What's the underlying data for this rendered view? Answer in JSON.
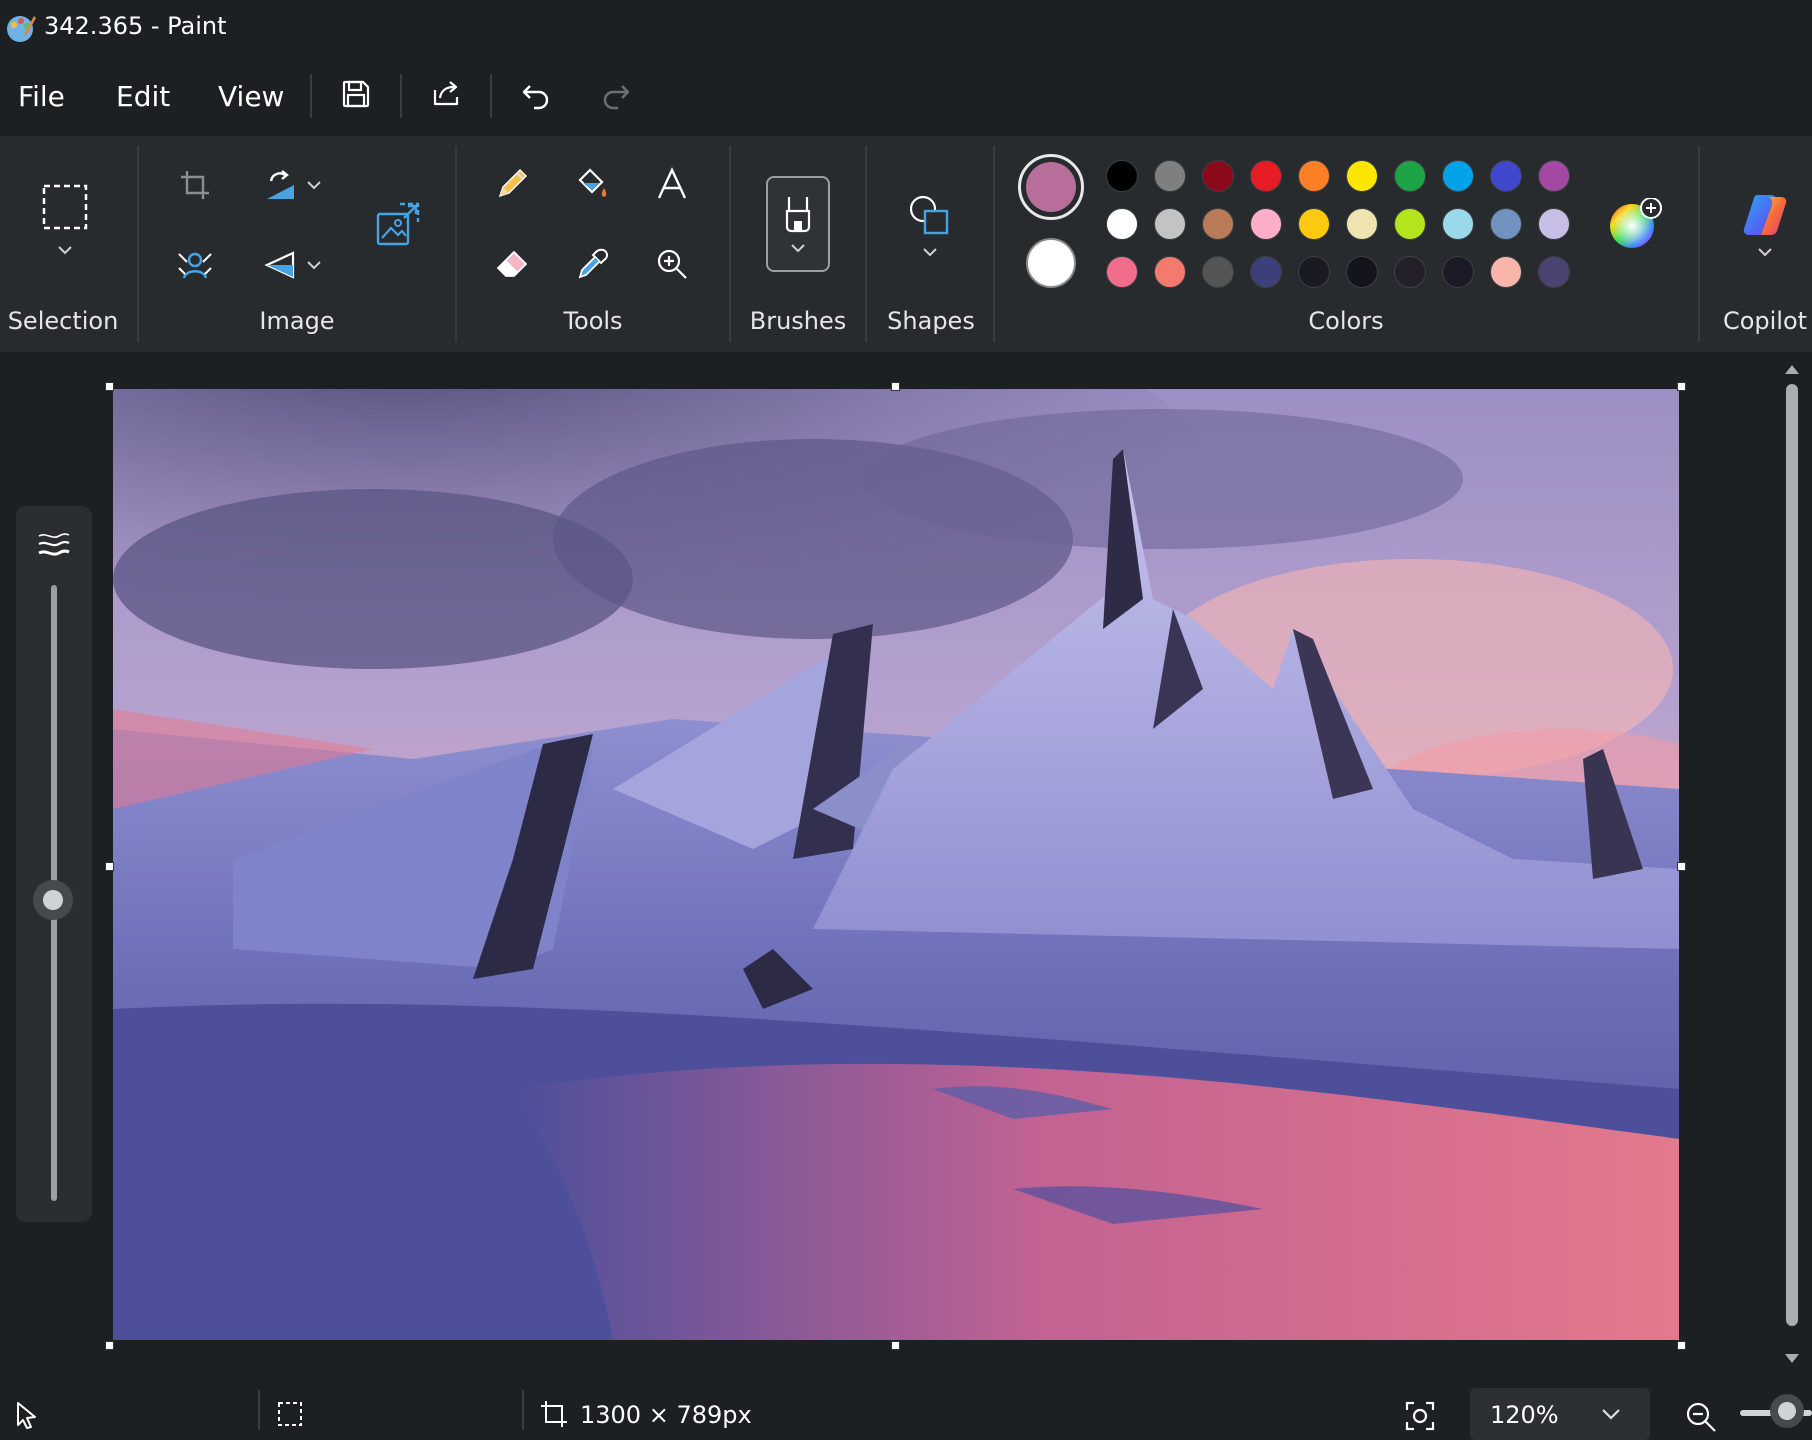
{
  "window": {
    "title": "342.365 - Paint"
  },
  "menu": {
    "file": "File",
    "edit": "Edit",
    "view": "View"
  },
  "ribbon": {
    "groups": {
      "selection": "Selection",
      "image": "Image",
      "tools": "Tools",
      "brushes": "Brushes",
      "shapes": "Shapes",
      "colors": "Colors",
      "copilot": "Copilot"
    }
  },
  "colors": {
    "primary": "#b86e9a",
    "secondary": "#ffffff",
    "palette": [
      [
        "#000000",
        "#7f7f7f",
        "#8b0a1a",
        "#e81c24",
        "#ff7f27",
        "#ffe600",
        "#1ea446",
        "#00a2e8",
        "#3f48cc",
        "#a349a4"
      ],
      [
        "#ffffff",
        "#c3c3c3",
        "#b97a57",
        "#ffaec9",
        "#ffc90e",
        "#efe4b0",
        "#b5e61d",
        "#99d9ea",
        "#7092be",
        "#c8bfe7"
      ],
      [
        "#f06d8c",
        "#f47a6e",
        "#545454",
        "#3b3f7a",
        "#1a1a22",
        "#14141c",
        "#23202a",
        "#1c1a26",
        "#f9b5a9",
        "#4a4270"
      ]
    ]
  },
  "status": {
    "canvas_size": "1300 × 789px",
    "zoom": "120%"
  }
}
